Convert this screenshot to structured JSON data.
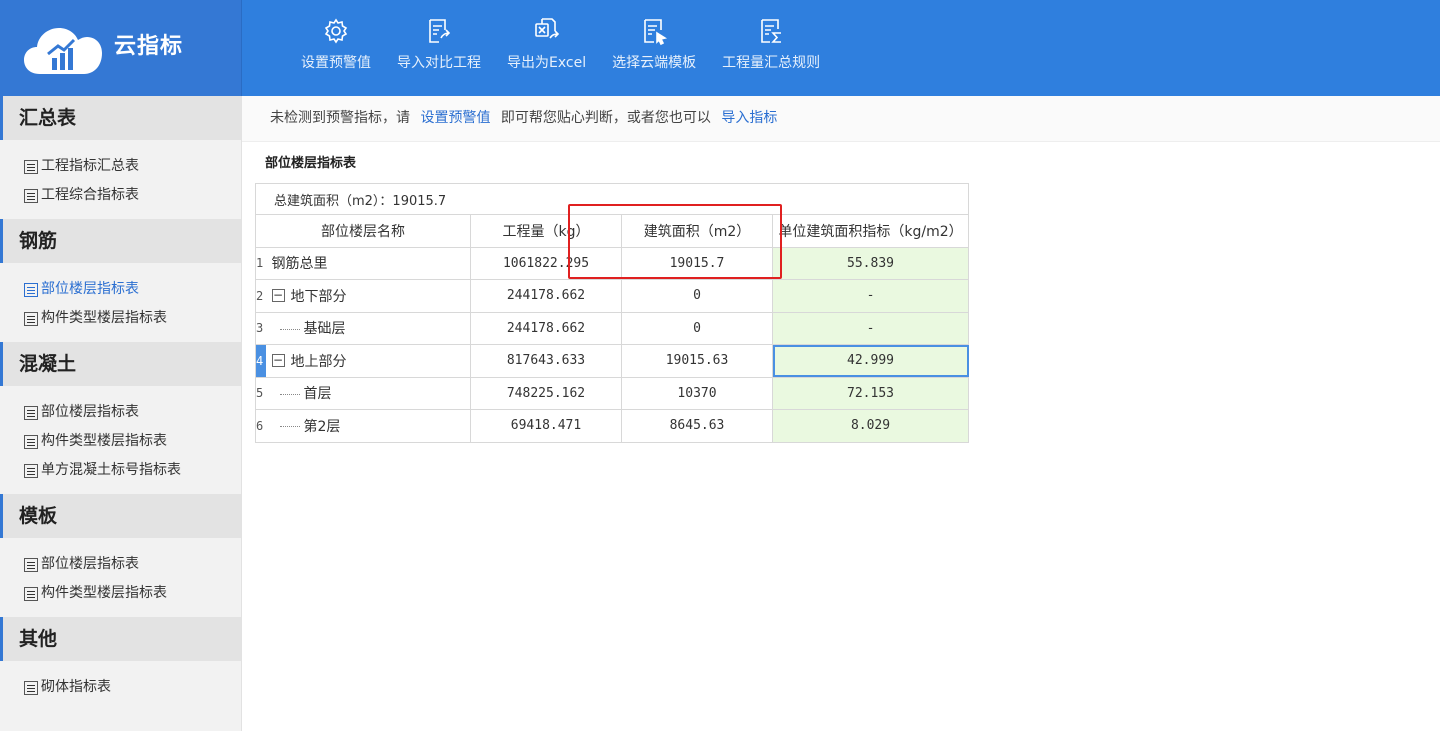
{
  "app": {
    "title": "云指标"
  },
  "toolbar": [
    {
      "label": "设置预警值",
      "icon": "gear-icon"
    },
    {
      "label": "导入对比工程",
      "icon": "import-doc-icon"
    },
    {
      "label": "导出为Excel",
      "icon": "export-excel-icon"
    },
    {
      "label": "选择云端模板",
      "icon": "cloud-template-icon"
    },
    {
      "label": "工程量汇总规则",
      "icon": "summary-rule-icon"
    }
  ],
  "sidebar": {
    "sections": [
      {
        "title": "汇总表",
        "items": [
          "工程指标汇总表",
          "工程综合指标表"
        ]
      },
      {
        "title": "钢筋",
        "items": [
          "部位楼层指标表",
          "构件类型楼层指标表"
        ]
      },
      {
        "title": "混凝土",
        "items": [
          "部位楼层指标表",
          "构件类型楼层指标表",
          "单方混凝土标号指标表"
        ]
      },
      {
        "title": "模板",
        "items": [
          "部位楼层指标表",
          "构件类型楼层指标表"
        ]
      },
      {
        "title": "其他",
        "items": [
          "砌体指标表"
        ]
      }
    ],
    "active": "钢筋/部位楼层指标表"
  },
  "notice": {
    "text1": "未检测到预警指标，请",
    "link1": "设置预警值",
    "text2": "即可帮您贴心判断，或者您也可以",
    "link2": "导入指标"
  },
  "sheet": {
    "title": "部位楼层指标表",
    "total": "总建筑面积（m2）：19015.7",
    "headers": [
      "部位楼层名称",
      "工程量（kg）",
      "建筑面积（m2）",
      "单位建筑面积指标（kg/m2）"
    ],
    "rows": [
      {
        "no": "1",
        "name": "钢筋总里",
        "qty": "1061822.295",
        "area": "19015.7",
        "index": "55.839"
      },
      {
        "no": "2",
        "name": "地下部分",
        "qty": "244178.662",
        "area": "0",
        "index": "-"
      },
      {
        "no": "3",
        "name": "基础层",
        "qty": "244178.662",
        "area": "0",
        "index": "-"
      },
      {
        "no": "4",
        "name": "地上部分",
        "qty": "817643.633",
        "area": "19015.63",
        "index": "42.999"
      },
      {
        "no": "5",
        "name": "首层",
        "qty": "748225.162",
        "area": "10370",
        "index": "72.153"
      },
      {
        "no": "6",
        "name": "第2层",
        "qty": "69418.471",
        "area": "8645.63",
        "index": "8.029"
      }
    ]
  },
  "colors": {
    "header_bg": "#2f7fde",
    "accent": "#2b6fd1",
    "highlight_box": "#e02020",
    "index_cell_bg": "#eaf9e0"
  }
}
